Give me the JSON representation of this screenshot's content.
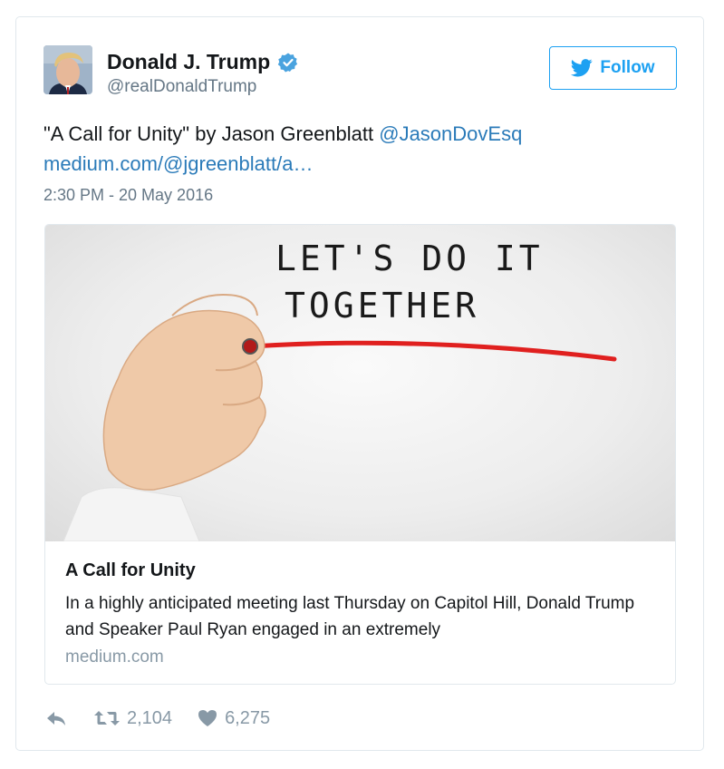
{
  "author": {
    "name": "Donald J. Trump",
    "handle": "@realDonaldTrump",
    "verified": true,
    "avatar_icon": "profile-photo"
  },
  "follow": {
    "label": "Follow",
    "icon": "twitter-bird-icon"
  },
  "tweet": {
    "text_before_mention": "\"A Call for Unity\" by Jason Greenblatt ",
    "mention": "@JasonDovEsq",
    "link": "medium.com/@jgreenblatt/a…",
    "timestamp": "2:30 PM - 20 May 2016"
  },
  "card": {
    "image_text_line1": "LET'S DO IT",
    "image_text_line2": "TOGETHER",
    "title": "A Call for Unity",
    "description": "In a highly anticipated meeting last Thursday on Capitol Hill, Donald Trump and Speaker Paul Ryan engaged in an extremely",
    "domain": "medium.com"
  },
  "actions": {
    "retweet_count": "2,104",
    "like_count": "6,275"
  },
  "colors": {
    "accent": "#1da1f2",
    "link": "#2b7bb9",
    "secondary_text": "#657786",
    "border": "#e1e8ed",
    "marker_red": "#e0201f"
  }
}
